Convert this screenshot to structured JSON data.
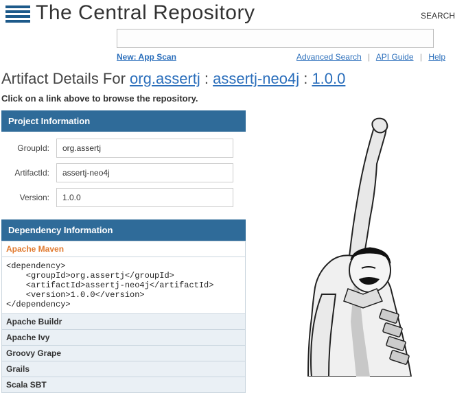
{
  "site": {
    "title": "The Central Repository",
    "search_label": "SEARCH"
  },
  "links": {
    "app_scan": "New: App Scan",
    "advanced_search": "Advanced Search",
    "api_guide": "API Guide",
    "help": "Help"
  },
  "search": {
    "placeholder": ""
  },
  "heading": {
    "prefix": "Artifact Details For ",
    "group": "org.assertj",
    "artifact": "assertj-neo4j",
    "version": "1.0.0",
    "sep": " : "
  },
  "instruction": "Click on a link above to browse the repository.",
  "panels": {
    "project_info": "Project Information",
    "dependency_info": "Dependency Information"
  },
  "project": {
    "labels": {
      "group": "GroupId:",
      "artifact": "ArtifactId:",
      "version": "Version:"
    },
    "group": "org.assertj",
    "artifact": "assertj-neo4j",
    "version": "1.0.0"
  },
  "dependency": {
    "items": {
      "maven": "Apache Maven",
      "buildr": "Apache Buildr",
      "ivy": "Apache Ivy",
      "grape": "Groovy Grape",
      "grails": "Grails",
      "sbt": "Scala SBT"
    },
    "maven_xml": "<dependency>\n    <groupId>org.assertj</groupId>\n    <artifactId>assertj-neo4j</artifactId>\n    <version>1.0.0</version>\n</dependency>"
  }
}
